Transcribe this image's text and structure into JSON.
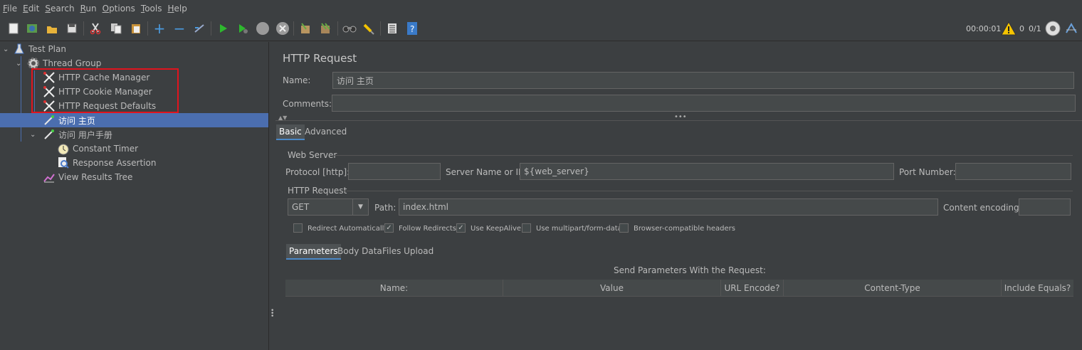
{
  "menu": [
    "File",
    "Edit",
    "Search",
    "Run",
    "Options",
    "Tools",
    "Help"
  ],
  "toolbar": {
    "icons": [
      "new-icon",
      "templates-icon",
      "open-icon",
      "save-icon",
      "cut-icon",
      "copy-icon",
      "paste-icon",
      "expand-icon",
      "collapse-icon",
      "toggle-icon",
      "start-icon",
      "start-no-pause-icon",
      "stop-icon",
      "shutdown-icon",
      "clear-icon",
      "clear-all-icon",
      "search-icon",
      "reset-search-icon",
      "function-helper-icon",
      "help-icon"
    ],
    "elapsed": "00:00:01",
    "warnings": "0",
    "threads": "0/1"
  },
  "tree": {
    "nodes": [
      {
        "label": "Test Plan"
      },
      {
        "label": "Thread Group"
      },
      {
        "label": "HTTP Cache Manager"
      },
      {
        "label": "HTTP Cookie Manager"
      },
      {
        "label": "HTTP Request Defaults"
      },
      {
        "label": "访问 主页"
      },
      {
        "label": "访问 用户手册"
      },
      {
        "label": "Constant Timer"
      },
      {
        "label": "Response Assertion"
      },
      {
        "label": "View Results Tree"
      }
    ]
  },
  "panel": {
    "title": "HTTP Request",
    "name_label": "Name:",
    "name_value": "访问 主页",
    "comments_label": "Comments:",
    "comments_value": "",
    "tabs": [
      "Basic",
      "Advanced"
    ],
    "web_server": {
      "legend": "Web Server",
      "protocol_label": "Protocol [http]:",
      "protocol_value": "",
      "server_label": "Server Name or IP:",
      "server_value": "${web_server}",
      "port_label": "Port Number:",
      "port_value": ""
    },
    "http_request": {
      "legend": "HTTP Request",
      "method": "GET",
      "path_label": "Path:",
      "path_value": "index.html",
      "encoding_label": "Content encoding:",
      "encoding_value": ""
    },
    "checkboxes": [
      {
        "label": "Redirect Automatically",
        "checked": false
      },
      {
        "label": "Follow Redirects",
        "checked": true
      },
      {
        "label": "Use KeepAlive",
        "checked": true
      },
      {
        "label": "Use multipart/form-data",
        "checked": false
      },
      {
        "label": "Browser-compatible headers",
        "checked": false
      }
    ],
    "sub_tabs": [
      "Parameters",
      "Body Data",
      "Files Upload"
    ],
    "params_caption": "Send Parameters With the Request:",
    "columns": [
      "Name:",
      "Value",
      "URL Encode?",
      "Content-Type",
      "Include Equals?"
    ]
  },
  "colors": {
    "selection": "#4b6eaf",
    "highlight_box": "#e0141e"
  }
}
